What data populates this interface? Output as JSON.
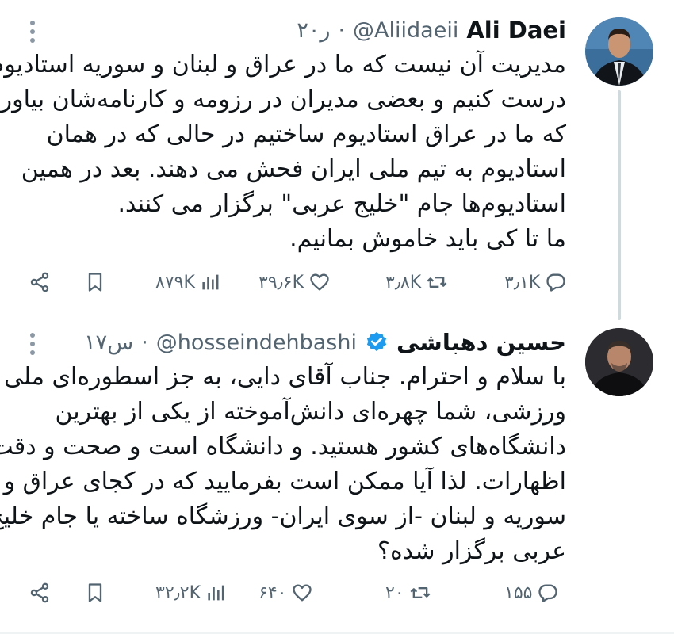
{
  "tweets": [
    {
      "author_name": "Ali Daei",
      "handle": "@Aliidaeii",
      "time": "۲۰ر",
      "body_lines": [
        "مدیریت آن نیست که ما در عراق و لبنان و سوریه استادیوم",
        "درست کنیم و بعضی مدیران در رزومه و کارنامه‌شان بیاورند",
        "که ما در عراق استادیوم ساختیم در حالی که در همان",
        "استادیوم به تیم ملی ایران فحش می دهند. بعد در همین",
        "استادیوم‌ها جام \"خلیج عربی\" برگزار می کنند.",
        "ما تا کی باید خاموش بمانیم."
      ],
      "stats": {
        "views": "۸۷۹K",
        "likes": "۳۹٫۶K",
        "retweets": "۳٫۸K",
        "replies": "۳٫۱K"
      },
      "verified": false
    },
    {
      "author_name": "حسین دهباشی",
      "handle": "@hosseindehbashi",
      "time": "۱۷س",
      "body_lines": [
        "با سلام و احترام. جناب آقای دایی، به جز اسطوره‌ای ملی و",
        "ورزشی، شما چهره‌ای دانش‌آموخته از یکی از بهترین",
        "دانشگاه‌های کشور هستید. و دانشگاه است و صحت و دقت",
        "اظهارات. لذا آیا ممکن است بفرمایید که در کجای عراق و",
        "سوریه و لبنان -از سوی ایران- ورزشگاه ساخته یا جام خلیج",
        "عربی برگزار شده؟"
      ],
      "stats": {
        "views": "۳۲٫۲K",
        "likes": "۶۴۰",
        "retweets": "۲۰",
        "replies": "۱۵۵"
      },
      "verified": true
    }
  ],
  "colors": {
    "verified": "#1d9bf0",
    "muted": "#536471",
    "text": "#0f1419"
  },
  "icons": [
    "more-icon",
    "share-icon",
    "bookmark-icon",
    "views-icon",
    "like-icon",
    "retweet-icon",
    "reply-icon",
    "verified-icon"
  ]
}
